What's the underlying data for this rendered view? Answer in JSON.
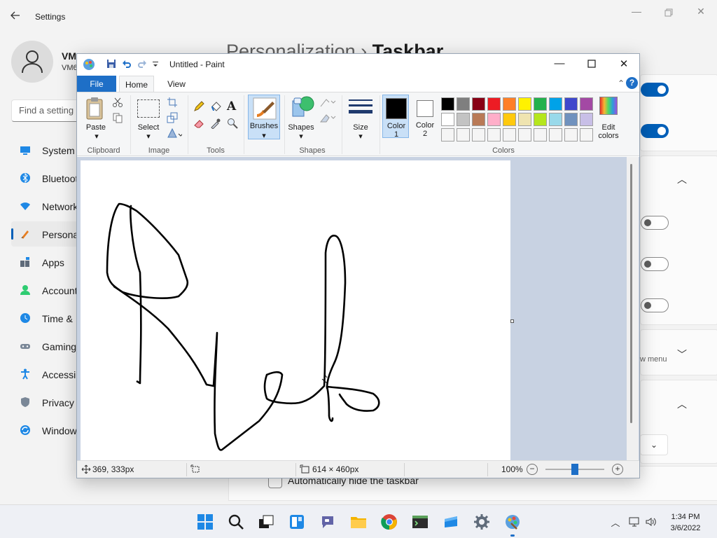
{
  "settings": {
    "window_title": "Settings",
    "user_name": "VM",
    "user_sub": "VM6",
    "search_placeholder": "Find a setting",
    "heading_parent": "Personalization",
    "heading_separator": "›",
    "heading_current": "Taskbar",
    "nav": [
      {
        "label": "System",
        "icon": "system-icon"
      },
      {
        "label": "Bluetoot",
        "icon": "bluetooth-icon"
      },
      {
        "label": "Network",
        "icon": "network-icon"
      },
      {
        "label": "Persona",
        "icon": "personalization-icon"
      },
      {
        "label": "Apps",
        "icon": "apps-icon"
      },
      {
        "label": "Account",
        "icon": "accounts-icon"
      },
      {
        "label": "Time &",
        "icon": "time-icon"
      },
      {
        "label": "Gaming",
        "icon": "gaming-icon"
      },
      {
        "label": "Accessib",
        "icon": "accessibility-icon"
      },
      {
        "label": "Privacy &",
        "icon": "privacy-icon"
      },
      {
        "label": "Window",
        "icon": "windows-update-icon"
      }
    ],
    "active_nav": "Persona",
    "toggles": [
      "on",
      "on",
      "off",
      "off",
      "off"
    ],
    "start_menu_fragment": "w menu",
    "auto_hide_label": "Automatically hide the taskbar",
    "auto_hide_checked": false
  },
  "paint": {
    "title": "Untitled - Paint",
    "tabs": {
      "file": "File",
      "home": "Home",
      "view": "View"
    },
    "groups": {
      "clipboard": "Clipboard",
      "image": "Image",
      "tools": "Tools",
      "shapes": "Shapes",
      "colors": "Colors"
    },
    "buttons": {
      "paste": "Paste",
      "select": "Select",
      "brushes": "Brushes",
      "shapes": "Shapes",
      "size": "Size",
      "color1_line1": "Color",
      "color1_line2": "1",
      "color2_line1": "Color",
      "color2_line2": "2",
      "edit_colors_line1": "Edit",
      "edit_colors_line2": "colors"
    },
    "color1": "#000000",
    "color2": "#ffffff",
    "palette": [
      [
        "#000000",
        "#7f7f7f",
        "#880015",
        "#ed1c24",
        "#ff7f27",
        "#fff200",
        "#22b14c",
        "#00a2e8",
        "#3f48cc",
        "#a349a4"
      ],
      [
        "#ffffff",
        "#c3c3c3",
        "#b97a57",
        "#ffaec9",
        "#ffc90e",
        "#efe4b0",
        "#b5e61d",
        "#99d9ea",
        "#7092be",
        "#c8bfe7"
      ],
      [
        "#f5f5f5",
        "#f5f5f5",
        "#f5f5f5",
        "#f5f5f5",
        "#f5f5f5",
        "#f5f5f5",
        "#f5f5f5",
        "#f5f5f5",
        "#f5f5f5",
        "#f5f5f5"
      ]
    ],
    "status": {
      "cursor_pos": "369, 333px",
      "canvas_size": "614 × 460px",
      "zoom": "100%"
    }
  },
  "taskbar": {
    "icons": [
      "start-icon",
      "search-icon",
      "task-view-icon",
      "widgets-icon",
      "chat-icon",
      "file-explorer-icon",
      "chrome-icon",
      "terminal-icon",
      "store-icon",
      "settings-icon",
      "paint-icon"
    ],
    "time": "1:34 PM",
    "date": "3/6/2022"
  }
}
